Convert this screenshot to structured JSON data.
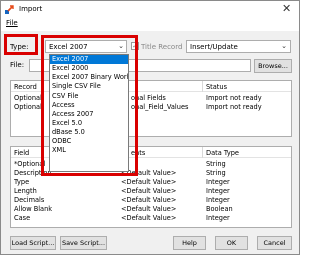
{
  "window": {
    "title": "Import",
    "close_glyph": "✕"
  },
  "menu": {
    "file": "File"
  },
  "type_row": {
    "label": "Type:",
    "selected": "Excel 2007",
    "title_record_label": "Title Record",
    "action_selected": "Insert/Update"
  },
  "file_row": {
    "label": "File:",
    "value": "",
    "browse_label": "Browse..."
  },
  "dropdown": {
    "options": [
      "Excel 2007",
      "Excel 2000",
      "Excel 2007 Binary Workb",
      "Single CSV File",
      "CSV File",
      "Access",
      "Access 2007",
      "Excel 5.0",
      "dBase 5.0",
      "ODBC",
      "XML"
    ],
    "selected_index": 0
  },
  "records_table": {
    "columns": [
      "Record",
      "Status"
    ],
    "rows": [
      {
        "record": "Optional",
        "mid": "onal Fields",
        "status": "Import not ready"
      },
      {
        "record": "Optional",
        "mid": "onal_Field_Values",
        "status": "Import not ready"
      }
    ]
  },
  "fields_table": {
    "columns": [
      "Field",
      "ents",
      "Data Type"
    ],
    "rows": [
      {
        "field": "*Optional",
        "value": "",
        "type": "String"
      },
      {
        "field": "Description",
        "value": "<Default Value>",
        "type": "String"
      },
      {
        "field": "Type",
        "value": "<Default Value>",
        "type": "Integer"
      },
      {
        "field": "Length",
        "value": "<Default Value>",
        "type": "Integer"
      },
      {
        "field": "Decimals",
        "value": "<Default Value>",
        "type": "Integer"
      },
      {
        "field": "Allow Blank",
        "value": "<Default Value>",
        "type": "Boolean"
      },
      {
        "field": "Case",
        "value": "<Default Value>",
        "type": "Integer"
      }
    ]
  },
  "buttons": {
    "load": "Load Script...",
    "save": "Save Script...",
    "help": "Help",
    "ok": "OK",
    "cancel": "Cancel"
  },
  "colors": {
    "highlight": "#d90000",
    "selection": "#0078d7"
  }
}
